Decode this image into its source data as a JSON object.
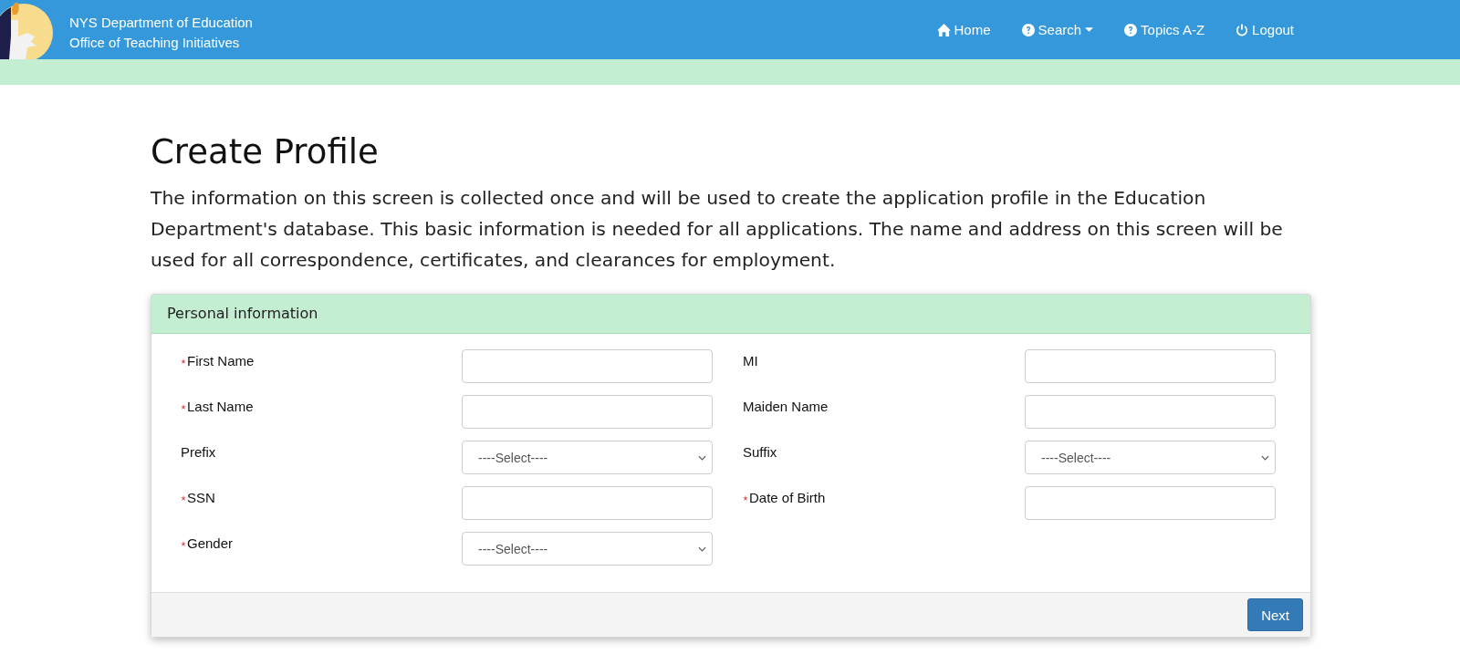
{
  "header": {
    "title_lines": [
      "NYS Department of Education",
      "Office of Teaching Initiatives"
    ],
    "nav": [
      {
        "label": "Home",
        "kind": "home",
        "dropdown": false
      },
      {
        "label": "Search",
        "kind": "help",
        "dropdown": true
      },
      {
        "label": "Topics A-Z",
        "kind": "help",
        "dropdown": false
      },
      {
        "label": "Logout",
        "kind": "logout",
        "dropdown": false
      }
    ]
  },
  "page": {
    "title": "Create Profile",
    "intro": "The information on this screen is collected once and will be used to create the application profile in the Education Department's database. This basic information is needed for all applications. The name and address on this screen will be used for all correspondence, certificates, and clearances for employment."
  },
  "panel": {
    "heading": "Personal information",
    "fields": [
      {
        "label": "First Name",
        "required": true,
        "kind": "text"
      },
      {
        "label": "MI",
        "required": false,
        "kind": "text"
      },
      {
        "label": "Last Name",
        "required": true,
        "kind": "text"
      },
      {
        "label": "Maiden Name",
        "required": false,
        "kind": "text"
      },
      {
        "label": "Prefix",
        "required": false,
        "kind": "select",
        "value": "----Select----"
      },
      {
        "label": "Suffix",
        "required": false,
        "kind": "select",
        "value": "----Select----"
      },
      {
        "label": "SSN",
        "required": true,
        "kind": "text"
      },
      {
        "label": "Date of Birth",
        "required": true,
        "kind": "text"
      },
      {
        "label": "Gender",
        "required": true,
        "kind": "select",
        "value": "----Select----"
      }
    ],
    "button": "Next"
  }
}
